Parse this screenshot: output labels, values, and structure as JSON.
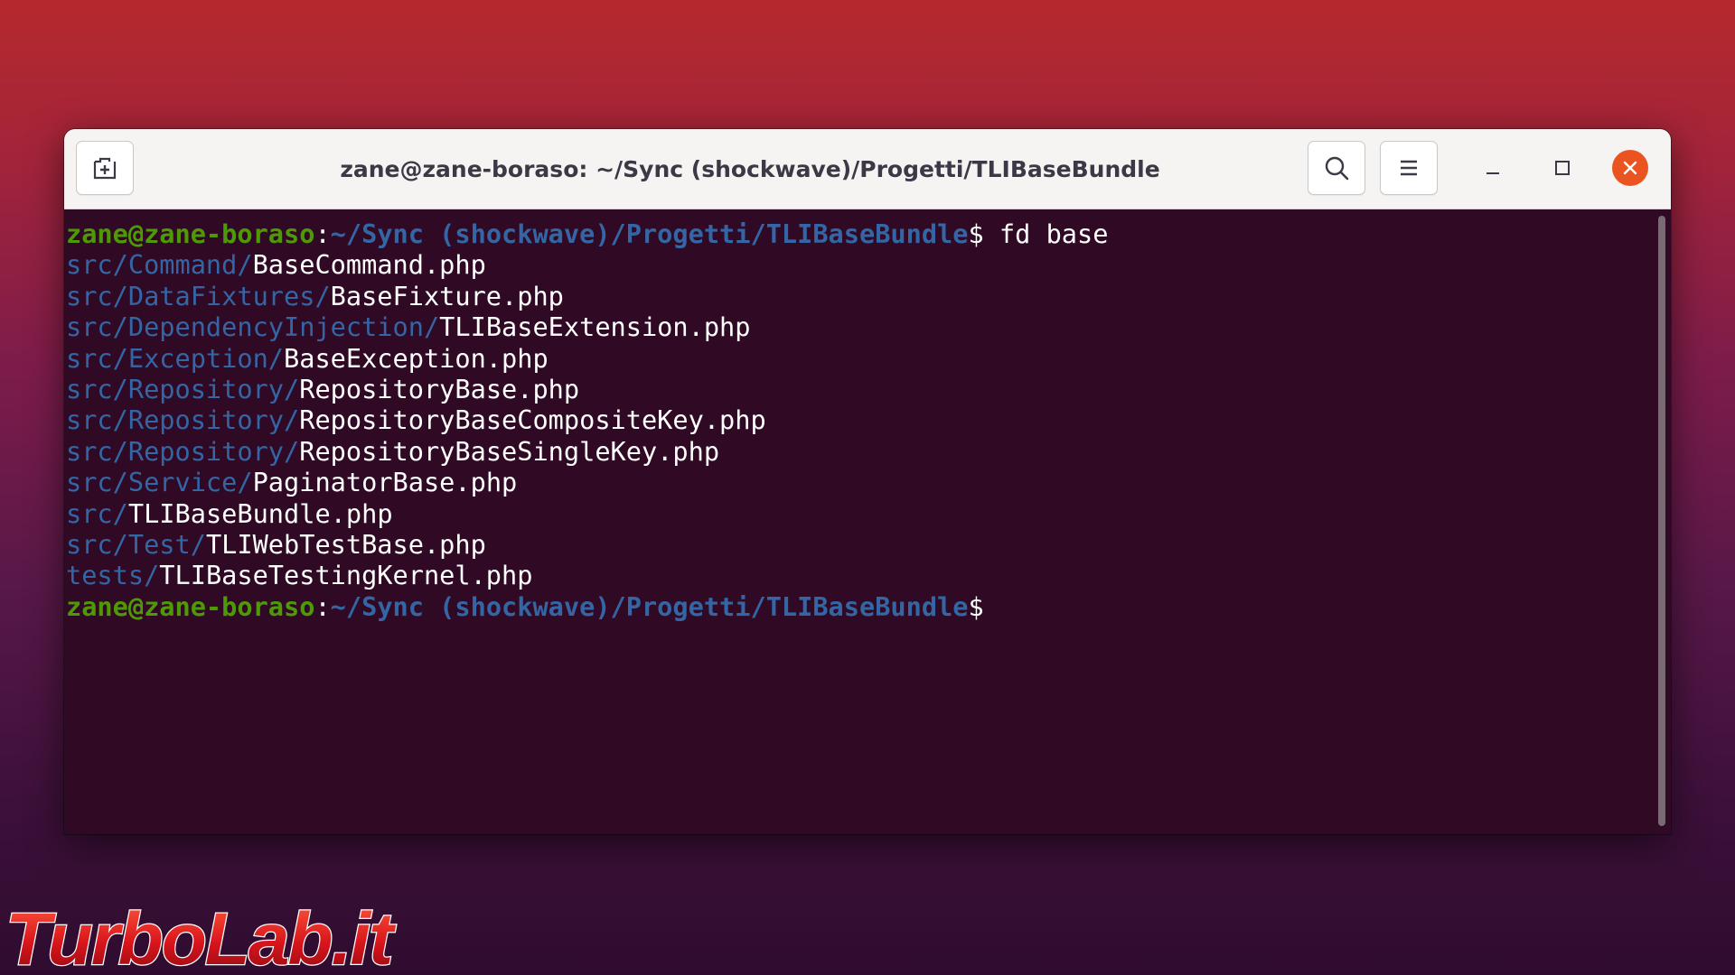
{
  "window": {
    "title": "zane@zane-boraso: ~/Sync (shockwave)/Progetti/TLIBaseBundle",
    "buttons": {
      "new_tab": "new-tab-icon",
      "search": "search-icon",
      "menu": "hamburger-menu-icon",
      "minimize": "minimize-icon",
      "maximize": "maximize-icon",
      "close": "close-icon"
    }
  },
  "terminal": {
    "prompt": {
      "user_host": "zane@zane-boraso",
      "separator": ":",
      "path": "~/Sync (shockwave)/Progetti/TLIBaseBundle",
      "symbol": "$"
    },
    "command": " fd base",
    "results": [
      {
        "dir": "src/Command/",
        "file": "BaseCommand.php"
      },
      {
        "dir": "src/DataFixtures/",
        "file": "BaseFixture.php"
      },
      {
        "dir": "src/DependencyInjection/",
        "file": "TLIBaseExtension.php"
      },
      {
        "dir": "src/Exception/",
        "file": "BaseException.php"
      },
      {
        "dir": "src/Repository/",
        "file": "RepositoryBase.php"
      },
      {
        "dir": "src/Repository/",
        "file": "RepositoryBaseCompositeKey.php"
      },
      {
        "dir": "src/Repository/",
        "file": "RepositoryBaseSingleKey.php"
      },
      {
        "dir": "src/Service/",
        "file": "PaginatorBase.php"
      },
      {
        "dir": "src/",
        "file": "TLIBaseBundle.php"
      },
      {
        "dir": "src/Test/",
        "file": "TLIWebTestBase.php"
      },
      {
        "dir": "tests/",
        "file": "TLIBaseTestingKernel.php"
      }
    ]
  },
  "watermark": {
    "text": "TurboLab.it"
  },
  "colors": {
    "prompt_user": "#4e9a06",
    "prompt_path": "#3465a4",
    "terminal_bg": "#300a24",
    "close_button": "#e95420"
  }
}
